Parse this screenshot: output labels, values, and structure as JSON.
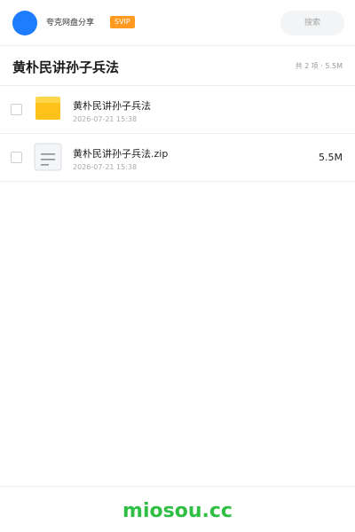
{
  "header": {
    "username": "夸克网盘分享",
    "badge": "SVIP",
    "search_placeholder": "搜索",
    "icons": {
      "avatar": "user-avatar-icon"
    }
  },
  "folder": {
    "title": "黄朴民讲孙子兵法",
    "summary": "共 2 项 · 5.5M"
  },
  "files": [
    {
      "name": "黄朴民讲孙子兵法",
      "date": "2026-07-21 15:38",
      "size": "",
      "type": "folder",
      "icon": "folder-icon"
    },
    {
      "name": "黄朴民讲孙子兵法.zip",
      "date": "2026-07-21 15:38",
      "size": "5.5M",
      "type": "zip",
      "icon": "document-icon"
    }
  ],
  "footer": {
    "watermark": "miosou.cc"
  },
  "colors": {
    "accent": "#1e7cff",
    "badge": "#ff9a1f",
    "folder": "#ffc21a",
    "watermark": "#2fbf45"
  }
}
